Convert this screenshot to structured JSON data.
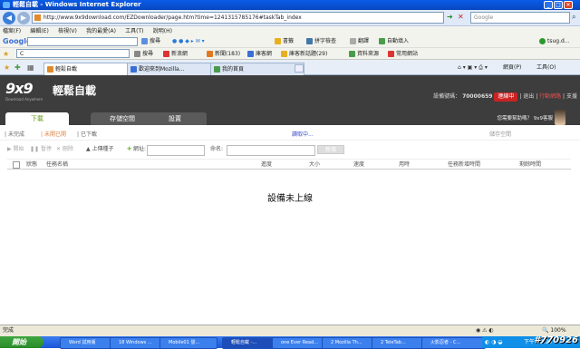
{
  "window": {
    "title": "輕鬆自載 - Windows Internet Explorer"
  },
  "address": {
    "url": "http://www.9x9download.com/EZDownloader/page.htm?time=1241315785176#taskTab_index",
    "search_placeholder": "Google"
  },
  "menubar": [
    "檔案(F)",
    "編輯(E)",
    "檢視(V)",
    "我的最愛(A)",
    "工具(T)",
    "說明(H)"
  ],
  "toolbar1": {
    "google": "Google",
    "search_btn": "搜尋",
    "bookmarks": "書籤",
    "pinyin": "拼字檢查",
    "translate": "翻譯",
    "autofill": "自動填入",
    "login": "tsug.d..."
  },
  "toolbar2": {
    "c_label": "C",
    "search": "搜尋",
    "news": "新浪網",
    "mail": "新聞(183)",
    "store": "庫客網",
    "store2": "庫客新話題(29)",
    "sites": "資料來源",
    "common": "常用網站"
  },
  "browser_tabs": [
    "輕鬆自載",
    "歡迎來到Mozilla...",
    "我的首頁"
  ],
  "browser_tools": {
    "page": "網頁(P)",
    "tools": "工具(O)"
  },
  "page": {
    "logo": "9x9",
    "logo_sub": "Download Anywhere",
    "brand": "輕鬆自載",
    "header_links": {
      "device_label": "設備號碼：",
      "device_no": "70000659",
      "online": "連線中",
      "logout": "退出",
      "help_red": "行動網路",
      "support": "支援"
    },
    "tabs": [
      "下載",
      "存儲空間",
      "設置"
    ],
    "hint": "您需要幫助嗎？ 9x9客服",
    "filters": {
      "incomplete": "未完成",
      "done": "未開已開",
      "downloaded": "已下載",
      "status": "讀取中...",
      "space": "儲存空間"
    },
    "actions": {
      "start": "開始",
      "pause": "暫停",
      "delete": "刪除",
      "upload": "上傳種子",
      "url_label": "網址:",
      "name_label": "命名:",
      "add_btn": "新增"
    },
    "columns": [
      "狀態",
      "任務名稱",
      "進度",
      "大小",
      "速度",
      "用時",
      "任務新增時間",
      "剩餘時間"
    ],
    "empty_message": "設備未上線"
  },
  "statusbar": {
    "left": "完成",
    "zoom": "100%"
  },
  "taskbar": {
    "start": "開始",
    "items": [
      "Word 試用版",
      "18 Windows ...",
      "Mobile01 發...",
      "輕鬆自載 -...",
      "one Ever Read...",
      "2 Mozilla Th...",
      "2 TeleTab...",
      "火影忍者 - C..."
    ],
    "clock": "下午 02:29",
    "watermark": "#770926"
  }
}
